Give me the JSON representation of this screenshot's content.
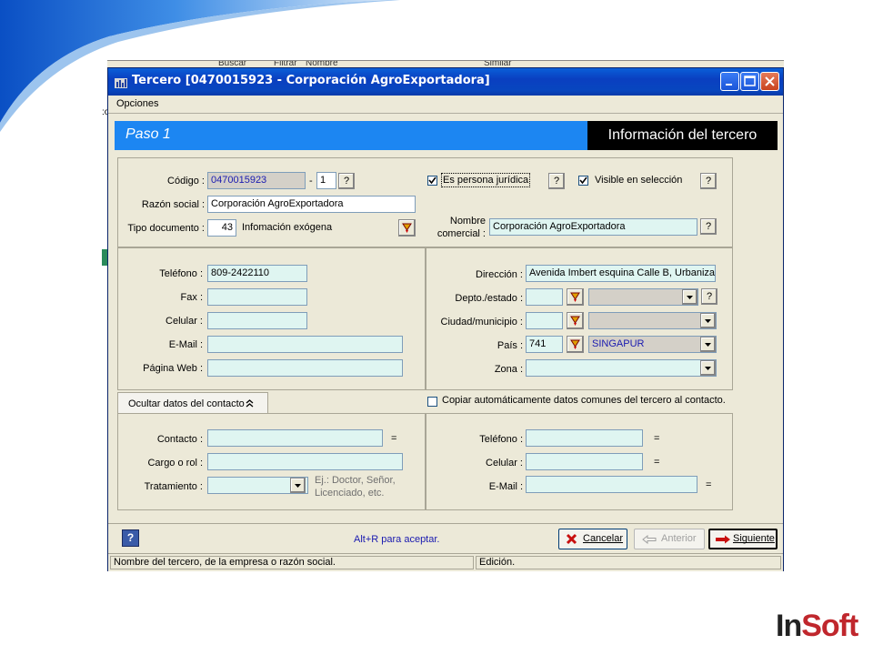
{
  "background_window": {
    "text_a": "Buscar",
    "text_b": "Filtrar",
    "text_c": "Nombre",
    "text_d": "Similar"
  },
  "window": {
    "title": "Tercero [0470015923 - Corporación AgroExportadora]",
    "menu": [
      "Opciones"
    ]
  },
  "banner": {
    "step": "Paso 1",
    "heading": "Información del tercero"
  },
  "general": {
    "codigo_label": "Código :",
    "codigo_value": "0470015923",
    "codigo_sep": "-",
    "codigo_suffix": "1",
    "help": "?",
    "persona_juridica_label": "Es persona jurídica",
    "persona_juridica_checked": true,
    "visible_label": "Visible en selección",
    "visible_checked": true,
    "razon_label": "Razón social :",
    "razon_value": "Corporación AgroExportadora",
    "tipo_doc_label": "Tipo documento :",
    "tipo_doc_code": "43",
    "tipo_doc_desc": "Infomación exógena",
    "nombre_comercial_label_1": "Nombre",
    "nombre_comercial_label_2": "comercial :",
    "nombre_comercial_value": "Corporación AgroExportadora"
  },
  "contact_left": {
    "telefono_label": "Teléfono :",
    "telefono_value": "809-2422110",
    "fax_label": "Fax :",
    "celular_label": "Celular :",
    "email_label": "E-Mail :",
    "web_label": "Página Web :"
  },
  "contact_right": {
    "direccion_label": "Dirección :",
    "direccion_value": "Avenida Imbert esquina Calle B, Urbanizaci",
    "depto_label": "Depto./estado :",
    "ciudad_label": "Ciudad/municipio :",
    "pais_label": "País :",
    "pais_code": "741",
    "pais_name": "SINGAPUR",
    "zona_label": "Zona :"
  },
  "contact_section": {
    "tab_label": "Ocultar datos del contacto",
    "tab_icon": "double-chevron-up",
    "copy_label": "Copiar automáticamente datos comunes del tercero al contacto.",
    "copy_checked": false,
    "contacto_label": "Contacto :",
    "cargo_label": "Cargo o rol :",
    "tratamiento_label": "Tratamiento :",
    "tratamiento_hint_1": "Ej.: Doctor, Señor,",
    "tratamiento_hint_2": "Licenciado, etc.",
    "tel_label": "Teléfono :",
    "cel_label": "Celular :",
    "mail_label": "E-Mail  :",
    "eq": "="
  },
  "footer": {
    "help_icon": "?",
    "hint": "Alt+R para aceptar.",
    "cancel_label": "Cancelar",
    "prev_label": "Anterior",
    "next_label": "Siguiente"
  },
  "status": {
    "message": "Nombre del tercero, de la empresa o razón social.",
    "mode": "Edición."
  },
  "logo": {
    "part1": "In",
    "part2": "Soft"
  },
  "colors": {
    "titlebar": "#0a3fc0",
    "banner": "#1c86f2",
    "field_bg": "#dff5f1",
    "logo_red": "#c0272d"
  }
}
